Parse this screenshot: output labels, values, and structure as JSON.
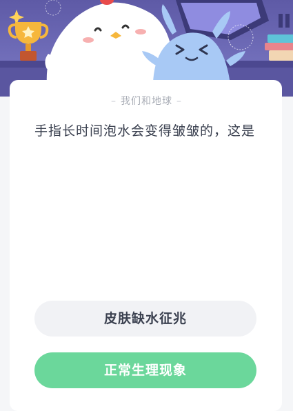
{
  "header": {
    "category": "我们和地球"
  },
  "question": {
    "text": "手指长时间泡水会变得皱皱的，这是"
  },
  "options": [
    {
      "label": "皮肤缺水征兆"
    },
    {
      "label": "正常生理现象"
    }
  ],
  "colors": {
    "banner": "#6f6cb8",
    "option_default": "#f1f2f5",
    "option_highlight": "#6bd79b",
    "text": "#3b4150"
  }
}
